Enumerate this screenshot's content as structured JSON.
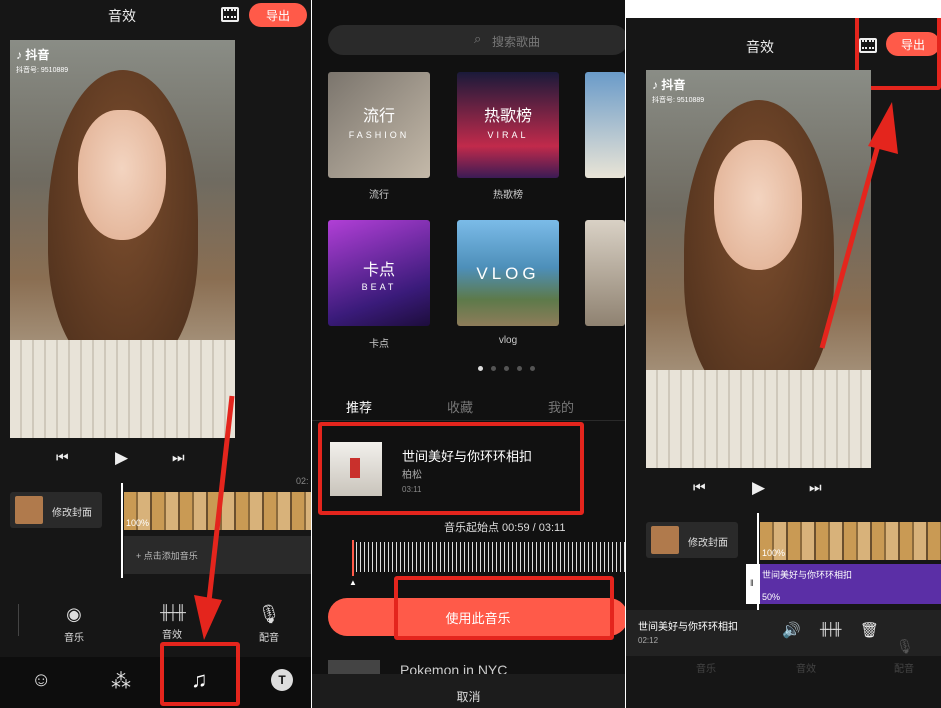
{
  "editor": {
    "title": "音效",
    "export_label": "导出",
    "watermark_brand": "抖音",
    "watermark_id": "抖音号: 9510889",
    "cover_label": "修改封面",
    "add_music_label": "+ 点击添加音乐",
    "clip_percent": "100%",
    "time_partial": "02:",
    "bottom_tools": [
      {
        "label": "音乐",
        "icon": "music-disc-icon"
      },
      {
        "label": "音效",
        "icon": "waveform-icon"
      },
      {
        "label": "配音",
        "icon": "microphone-icon"
      }
    ],
    "nav_icons": [
      "sticker-face-icon",
      "filter-icon",
      "music-note-icon",
      "text-icon"
    ]
  },
  "music_library": {
    "search_placeholder": "搜索歌曲",
    "categories": [
      {
        "label": "流行",
        "cover_title": "流行",
        "cover_sub": "FASHION"
      },
      {
        "label": "热歌榜",
        "cover_title": "热歌榜",
        "cover_sub": "VIRAL"
      },
      {
        "label": "卡点",
        "cover_title": "卡点",
        "cover_sub": "BEAT"
      },
      {
        "label": "vlog",
        "cover_title": "VLOG",
        "cover_sub": ""
      }
    ],
    "page_dots": 5,
    "tabs": [
      "推荐",
      "收藏",
      "我的"
    ],
    "active_tab": 0,
    "selected_song": {
      "title": "世间美好与你环环相扣",
      "artist": "柏松",
      "duration": "03:11"
    },
    "start_point": "音乐起始点 00:59 / 03:11",
    "use_button_label": "使用此音乐",
    "next_song_title": "Pokemon in NYC",
    "cancel_label": "取消"
  },
  "editor_after": {
    "title": "音效",
    "export_label": "导出",
    "watermark_brand": "抖音",
    "watermark_id": "抖音号: 9510889",
    "cover_label": "修改封面",
    "clip_percent": "100%",
    "music_clip_label": "世间美好与你环环相扣",
    "music_clip_percent": "50%",
    "song_title": "世间美好与你环环相扣",
    "song_time": "02:12",
    "faded_labels": [
      "音乐",
      "音效",
      "配音"
    ]
  },
  "colors": {
    "accent": "#ff5a49",
    "highlight": "#e4251d",
    "music_track": "#5b2fa6"
  }
}
